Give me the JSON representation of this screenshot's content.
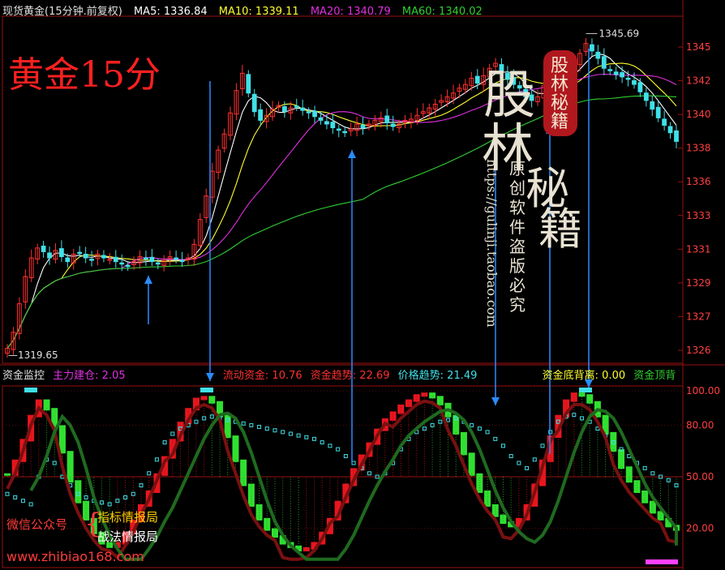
{
  "header": {
    "title": "现货黄金(15分钟.前复权)",
    "ma5": "MA5: 1336.84",
    "ma10": "MA10: 1339.11",
    "ma20": "MA20: 1340.79",
    "ma60": "MA60: 1340.02"
  },
  "overlay_title": "黄金15分",
  "price_labels": {
    "high": "1345.69",
    "low": "1319.65"
  },
  "price_axis_ticks": [
    "1345",
    "1342",
    "1340",
    "1338",
    "1336",
    "1333",
    "1331",
    "1329",
    "1327",
    "1326"
  ],
  "indicator_header": {
    "name": "资金监控",
    "main_build": "主力建仓: 2.05",
    "flow": "流动资金: 10.76",
    "trend": "资金趋势: 22.69",
    "price_trend": "价格趋势: 21.49",
    "bottom_div": "资金底背离: 0.00",
    "top_div": "资金顶背"
  },
  "indicator_axis_ticks": [
    "100.00",
    "80.00",
    "50.00",
    "20.00"
  ],
  "watermark": {
    "big1": "股",
    "big2": "林",
    "seal": "股林秘籍",
    "side1": "秘",
    "side2": "籍",
    "orig": "原创软件 盗版必究",
    "site": "https://gulinji.taobao.com"
  },
  "footer": {
    "wechat_label": "微信公众号",
    "account1": "指标情报局",
    "account2": "战法情报局",
    "url": "www.zhibiao168.com"
  },
  "colors": {
    "up": "#ff3030",
    "down": "#40e0e8",
    "ma5": "#ffffff",
    "ma10": "#ffff30",
    "ma20": "#e030e0",
    "ma60": "#30d030",
    "arrow": "#2a8cff"
  },
  "chart_data": [
    {
      "type": "candlestick",
      "title": "现货黄金(15分钟.前复权)",
      "ylim": [
        1319,
        1347
      ],
      "series": [
        {
          "name": "MA5",
          "value": 1336.84
        },
        {
          "name": "MA10",
          "value": 1339.11
        },
        {
          "name": "MA20",
          "value": 1340.79
        },
        {
          "name": "MA60",
          "value": 1340.02
        }
      ],
      "close": [
        1320.2,
        1321.5,
        1323.8,
        1326.0,
        1327.5,
        1328.3,
        1328.0,
        1327.5,
        1328.1,
        1327.6,
        1327.2,
        1327.8,
        1327.9,
        1327.5,
        1327.3,
        1327.8,
        1327.5,
        1327.4,
        1327.2,
        1327.0,
        1326.8,
        1327.2,
        1327.6,
        1327.4,
        1327.2,
        1327.0,
        1327.3,
        1327.6,
        1327.4,
        1327.2,
        1327.5,
        1328.6,
        1330.6,
        1332.5,
        1334.5,
        1336.2,
        1337.5,
        1339.2,
        1341.0,
        1342.4,
        1340.8,
        1339.3,
        1338.6,
        1339.0,
        1339.5,
        1339.8,
        1339.3,
        1339.6,
        1339.7,
        1339.4,
        1339.2,
        1338.9,
        1338.6,
        1338.3,
        1338.0,
        1337.8,
        1337.6,
        1337.9,
        1338.3,
        1338.0,
        1338.3,
        1338.6,
        1338.8,
        1338.4,
        1338.1,
        1338.3,
        1338.6,
        1338.7,
        1339.0,
        1339.3,
        1339.6,
        1339.9,
        1340.2,
        1340.5,
        1340.8,
        1341.2,
        1341.5,
        1342.0,
        1341.6,
        1342.2,
        1342.8,
        1343.2,
        1342.5,
        1341.9,
        1341.5,
        1341.2,
        1340.5,
        1340.2,
        1340.5,
        1341.4,
        1341.7,
        1342.1,
        1341.8,
        1342.5,
        1343.2,
        1344.0,
        1344.8,
        1344.2,
        1343.6,
        1342.8,
        1342.6,
        1342.3,
        1342.1,
        1341.9,
        1341.5,
        1340.9,
        1340.2,
        1339.5,
        1338.8,
        1338.2,
        1337.6,
        1336.9
      ]
    },
    {
      "type": "line",
      "title": "资金监控",
      "ylim": [
        0,
        100
      ],
      "series": [
        {
          "name": "主力建仓",
          "value": 2.05
        },
        {
          "name": "流动资金",
          "value": 10.76
        },
        {
          "name": "资金趋势",
          "value": 22.69
        },
        {
          "name": "价格趋势",
          "value": 21.49
        },
        {
          "name": "资金底背离",
          "value": 0.0
        }
      ],
      "trend": [
        52,
        60,
        72,
        86,
        95,
        90,
        80,
        65,
        48,
        36,
        26,
        18,
        12,
        10,
        12,
        18,
        25,
        34,
        42,
        52,
        62,
        72,
        82,
        90,
        96,
        97,
        94,
        86,
        74,
        60,
        46,
        34,
        26,
        20,
        16,
        12,
        10,
        8,
        9,
        12,
        18,
        26,
        36,
        46,
        55,
        63,
        70,
        78,
        84,
        88,
        92,
        95,
        98,
        99,
        97,
        93,
        86,
        76,
        64,
        52,
        42,
        34,
        28,
        24,
        22,
        26,
        34,
        46,
        60,
        74,
        86,
        95,
        99,
        98,
        94,
        86,
        76,
        66,
        56,
        48,
        42,
        36,
        30,
        26,
        22,
        20
      ],
      "flow": [
        40,
        38,
        36,
        34,
        50,
        60,
        58,
        50,
        45,
        40,
        38,
        36,
        35,
        34,
        36,
        38,
        40,
        45,
        52,
        60,
        70,
        75,
        78,
        80,
        82,
        84,
        85,
        84,
        83,
        82,
        81,
        80,
        79,
        78,
        77,
        76,
        75,
        74,
        73,
        72,
        70,
        68,
        66,
        62,
        58,
        55,
        52,
        50,
        52,
        58,
        66,
        72,
        76,
        78,
        80,
        82,
        83,
        84,
        82,
        80,
        78,
        76,
        72,
        68,
        62,
        58,
        55,
        60,
        68,
        76,
        82,
        85,
        86,
        84,
        82,
        78,
        74,
        70,
        66,
        62,
        58,
        55,
        52,
        50,
        48,
        45
      ]
    }
  ]
}
